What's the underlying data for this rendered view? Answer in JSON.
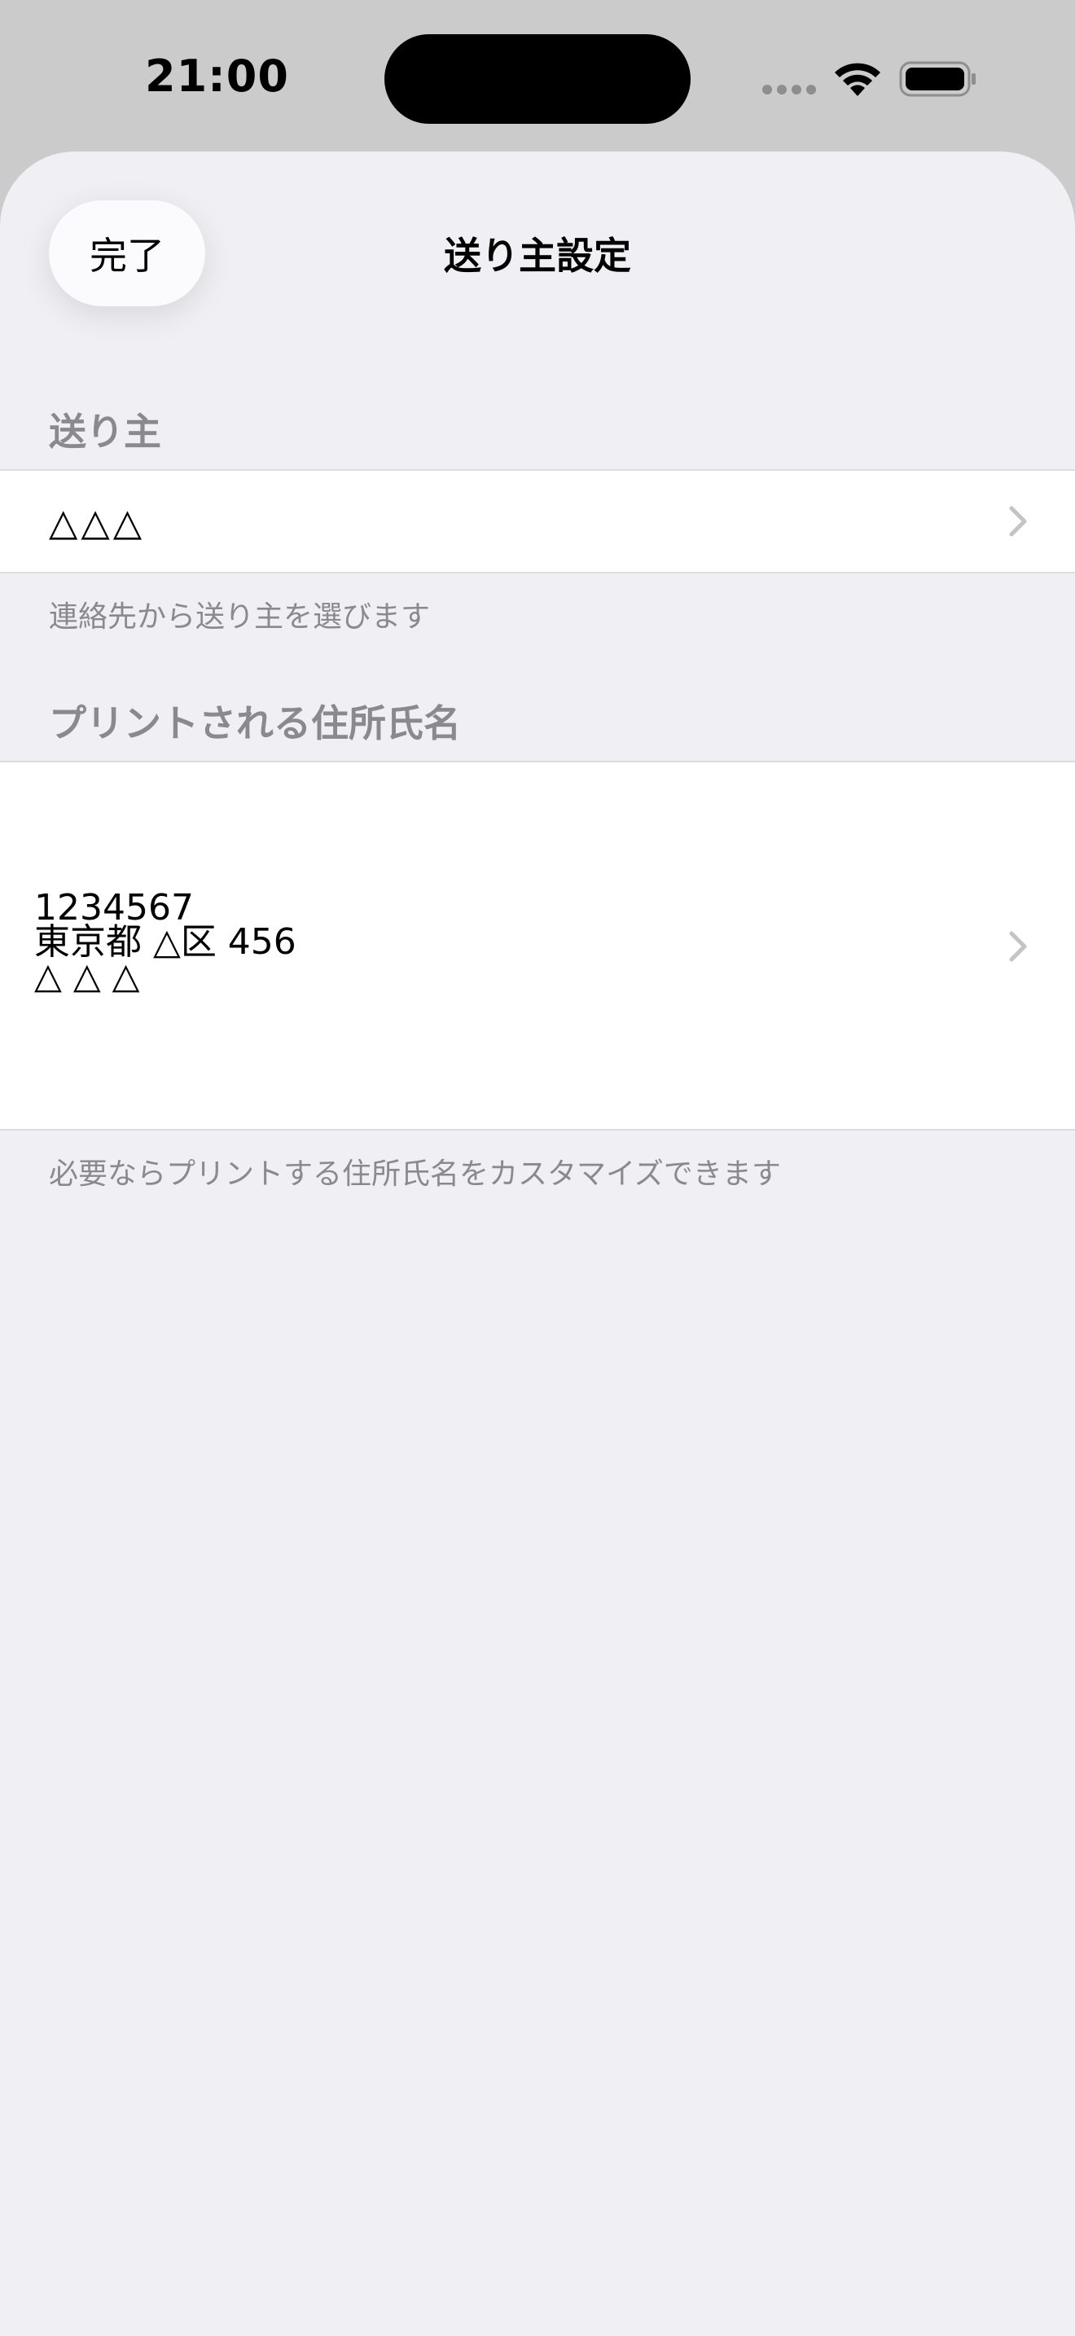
{
  "status_bar": {
    "time": "21:00",
    "icons": [
      "cellular-signal-icon",
      "wifi-icon",
      "battery-icon"
    ]
  },
  "navigation": {
    "done_label": "完了",
    "title": "送り主設定"
  },
  "sender_section": {
    "header": "送り主",
    "value": "△△△",
    "footer": "連絡先から送り主を選びます"
  },
  "address_section": {
    "header": "プリントされる住所氏名",
    "lines": [
      "1234567",
      "東京都 △区 456",
      "△ △ △"
    ],
    "footer": "必要ならプリントする住所氏名をカスタマイズできます"
  },
  "colors": {
    "background": "#efeff4",
    "status_bar": "#cbcbcb",
    "secondary_text": "#8a8a8e",
    "chevron": "#c4c4c7"
  }
}
